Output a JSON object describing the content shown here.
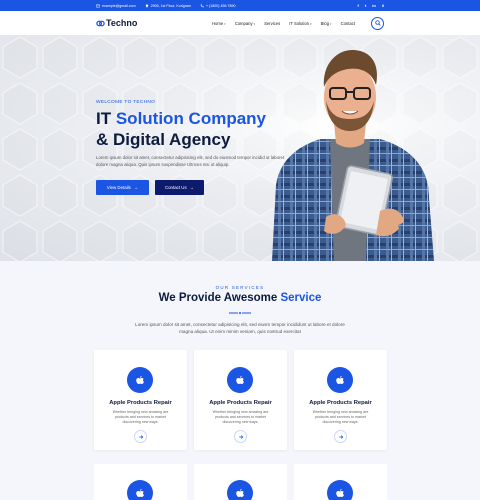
{
  "topbar": {
    "email": "example@gmail.com",
    "address": "2905, 1st Floor, Kurigram",
    "phone": "+ (1800) 456 7890",
    "social": [
      "f",
      "t",
      "in",
      "li"
    ]
  },
  "header": {
    "logo_text": "Techno",
    "nav": [
      {
        "label": "Home",
        "dropdown": true
      },
      {
        "label": "Company",
        "dropdown": true
      },
      {
        "label": "Services",
        "dropdown": false
      },
      {
        "label": "IT Solution",
        "dropdown": true
      },
      {
        "label": "Blog",
        "dropdown": true
      },
      {
        "label": "Contact",
        "dropdown": false
      }
    ],
    "search_icon": "search-icon"
  },
  "hero": {
    "eyebrow": "WELCOME TO TECHNO",
    "title_line1_plain": "IT ",
    "title_line1_blue": "Solution Company",
    "title_line2": "& Digital Agency",
    "description": "Lorem ipsum dolor sit amet, consectetur adipisicing elit, sed do eiusmod tempor incidid ut laboret dolore magna aliqua. Quis ipsum suspendisse Ultrices nisi ut aliquip.",
    "btn_view": "View Details",
    "btn_contact": "Contact Us"
  },
  "services": {
    "eyebrow": "OUR SERVICES",
    "title_plain": "We Provide Awesome ",
    "title_blue": "Service",
    "description": "Lorem ipsum dolor sit amet, consectetur adipisicing elit, sed eiusm tempor incididunt ut labore et dolore magna aliqua. Ut enim minim veniam, quis nostrud exercitat",
    "cards": [
      {
        "title": "Apple Products Repair",
        "text": "Whether bringing new amazing are products and services to market discovering new ways."
      },
      {
        "title": "Apple Products Repair",
        "text": "Whether bringing new amazing are products and services to market discovering new ways."
      },
      {
        "title": "Apple Products Repair",
        "text": "Whether bringing new amazing are products and services to market discovering new ways."
      }
    ]
  },
  "colors": {
    "brand_blue": "#1a55e3",
    "navy": "#0d1b3e",
    "contact_btn": "#0d1b6e"
  }
}
